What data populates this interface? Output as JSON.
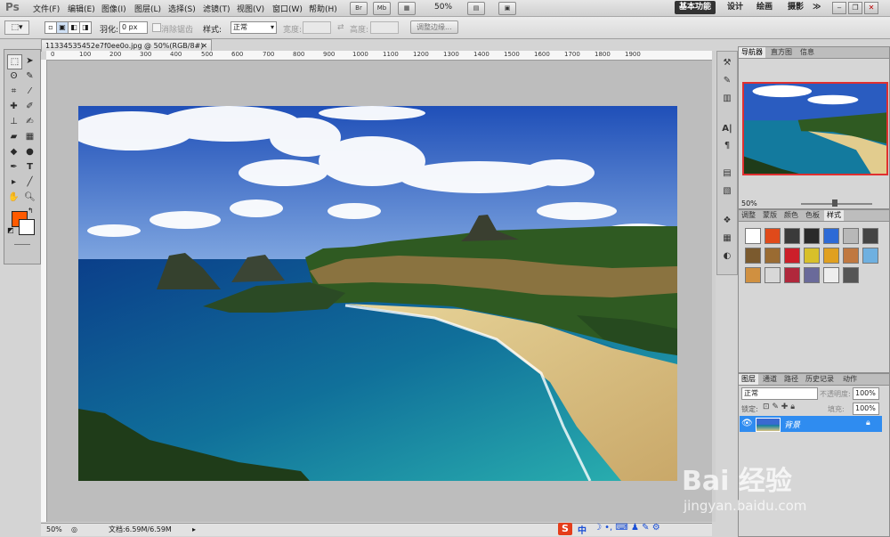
{
  "app": {
    "logo": "Ps"
  },
  "menu": {
    "items": [
      "文件(F)",
      "编辑(E)",
      "图像(I)",
      "图层(L)",
      "选择(S)",
      "滤镜(T)",
      "视图(V)",
      "窗口(W)",
      "帮助(H)"
    ]
  },
  "top_toolbar": {
    "zoom": "50%",
    "br": "Br",
    "mb": "Mb"
  },
  "workspaces": {
    "active": "基本功能",
    "items": [
      "设计",
      "绘画",
      "摄影"
    ],
    "more": "≫"
  },
  "window_controls": [
    "‒",
    "❐",
    "✕"
  ],
  "options_bar": {
    "feather_label": "羽化:",
    "feather_value": "0 px",
    "antialias_label": "消除锯齿",
    "style_label": "样式:",
    "style_value": "正常",
    "width_label": "宽度:",
    "height_label": "高度:",
    "refine_button": "调整边缘..."
  },
  "document": {
    "tab_title": "11334535452e7f0ee0o.jpg @ 50%(RGB/8#)",
    "close": "✕",
    "ruler_ticks": [
      "0",
      "100",
      "200",
      "300",
      "400",
      "500",
      "600",
      "700",
      "800",
      "900",
      "1000",
      "1100",
      "1200",
      "1300",
      "1400",
      "1500",
      "1600",
      "1700",
      "1800",
      "1900"
    ]
  },
  "status": {
    "zoom": "50%",
    "doc_size": "文档:6.59M/6.59M"
  },
  "navigator": {
    "tabs": [
      "导航器",
      "直方图",
      "信息"
    ],
    "zoom": "50%"
  },
  "styles_panel": {
    "tabs": [
      "调整",
      "蒙版",
      "颜色",
      "色板",
      "样式"
    ],
    "swatches": [
      "#ffffff",
      "#e04a1a",
      "#3a3a3a",
      "#2a2a2a",
      "#2d6ad6",
      "#b8b8b8",
      "#444444",
      "#7b5a2e",
      "#9a6b32",
      "#cc1f2a",
      "#d8c02a",
      "#e0a020",
      "#c07840",
      "#6fb0e0",
      "#d09040",
      "#d8d8d8",
      "#b0283c",
      "#6a6a9a",
      "#eeeeee",
      "#555555"
    ]
  },
  "layers_panel": {
    "tabs": [
      "图层",
      "通道",
      "路径",
      "历史记录",
      "动作"
    ],
    "blend_mode": "正常",
    "opacity_label": "不透明度:",
    "opacity_value": "100%",
    "lock_label": "锁定:",
    "fill_label": "填充:",
    "fill_value": "100%",
    "layer_name": "背景"
  },
  "colors": {
    "foreground": "#ff5a00",
    "background": "#ffffff",
    "accent": "#2f8cf0"
  },
  "taskbar": {
    "ime_label": "中"
  },
  "watermark": {
    "brand": "Bai 经验",
    "url": "jingyan.baidu.com"
  }
}
